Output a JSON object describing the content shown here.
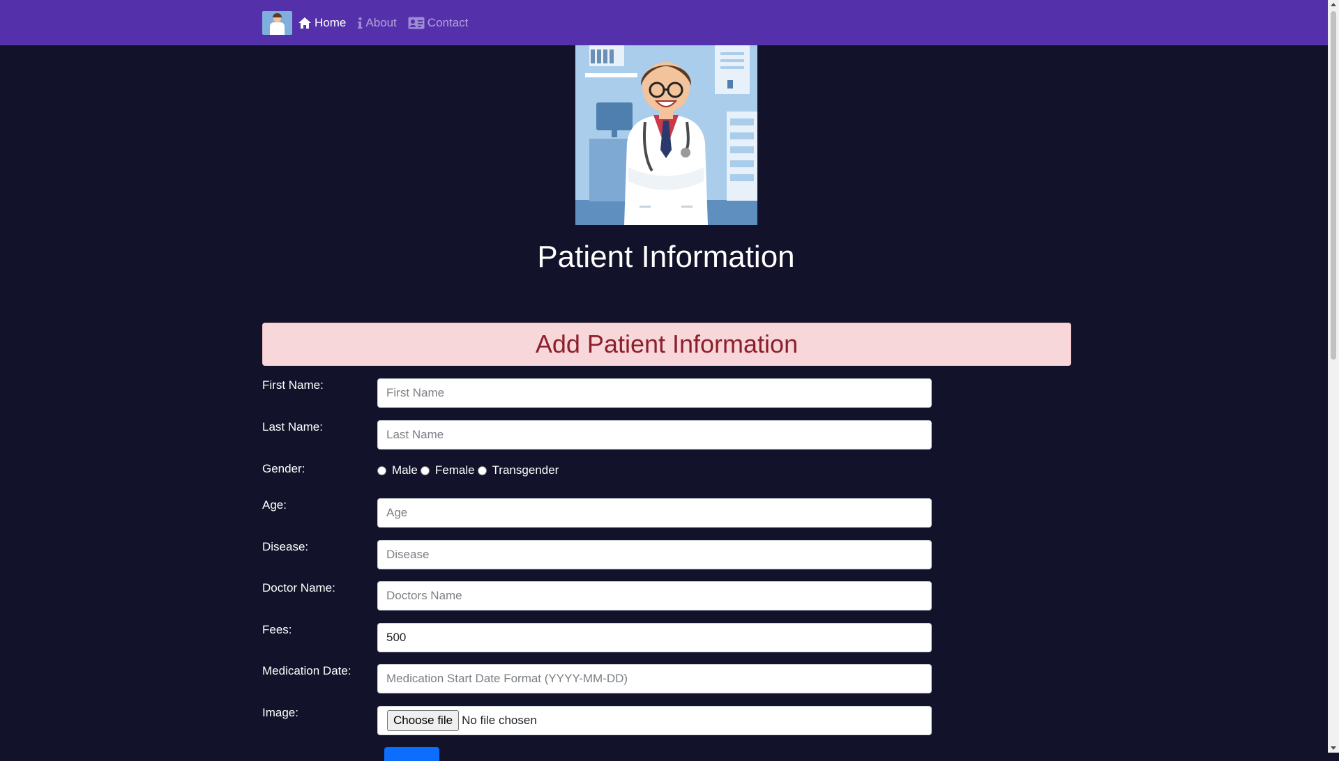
{
  "nav": {
    "links": [
      {
        "label": "Home",
        "icon": "home-icon",
        "active": true
      },
      {
        "label": "About",
        "icon": "info-icon",
        "active": false
      },
      {
        "label": "Contact",
        "icon": "contact-card-icon",
        "active": false
      }
    ]
  },
  "header": {
    "title": "Patient Information"
  },
  "form": {
    "heading": "Add Patient Information",
    "first_name": {
      "label": "First Name:",
      "placeholder": "First Name"
    },
    "last_name": {
      "label": "Last Name:",
      "placeholder": "Last Name"
    },
    "gender": {
      "label": "Gender:",
      "options": [
        "Male",
        "Female",
        "Transgender"
      ]
    },
    "age": {
      "label": "Age:",
      "placeholder": "Age"
    },
    "disease": {
      "label": "Disease:",
      "placeholder": "Disease"
    },
    "doctor_name": {
      "label": "Doctor Name:",
      "placeholder": "Doctors Name"
    },
    "fees": {
      "label": "Fees:",
      "value": "500"
    },
    "medication_date": {
      "label": "Medication Date:",
      "placeholder": "Medication Start Date Format (YYYY-MM-DD)"
    },
    "image": {
      "label": "Image:",
      "button": "Choose file",
      "status": "No file chosen"
    }
  },
  "colors": {
    "navbar": "#5430ab",
    "background": "#12122a",
    "alert_bg": "#f8d7da",
    "alert_text": "#8c1f2b",
    "primary": "#0d6efd"
  }
}
